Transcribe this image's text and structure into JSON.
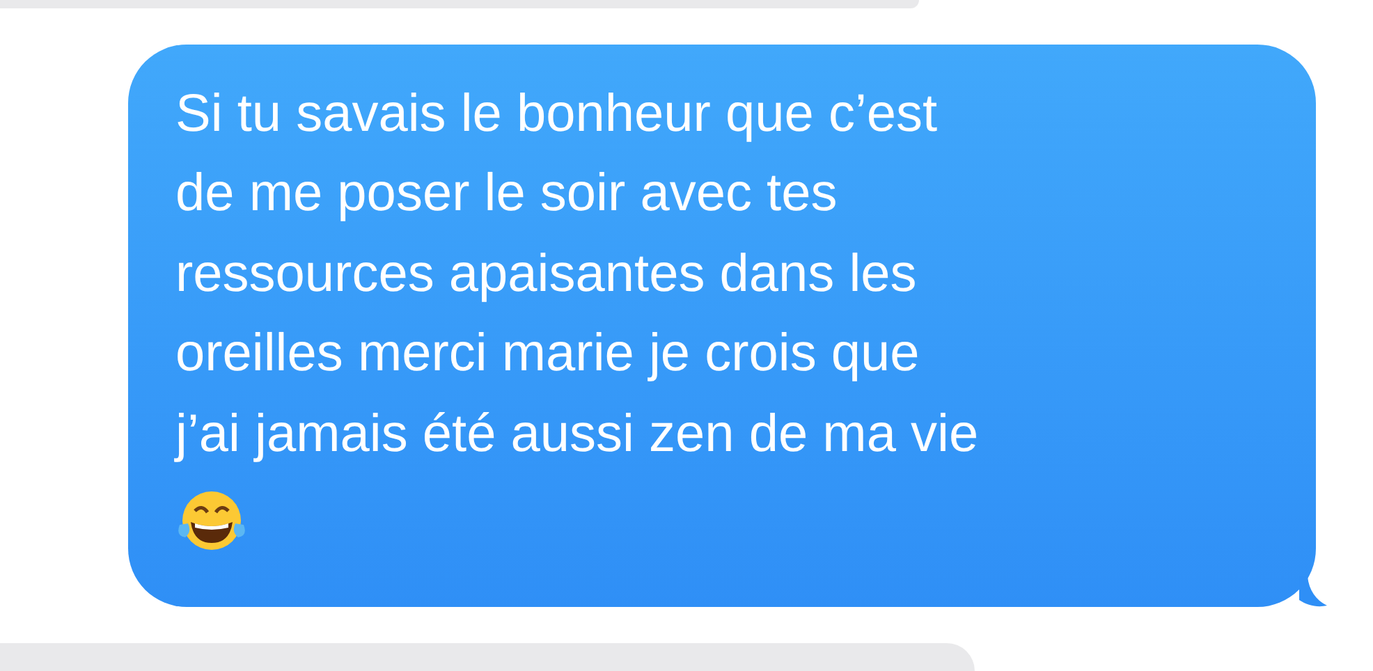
{
  "messages": [
    {
      "kind": "received"
    },
    {
      "kind": "sent",
      "text": "Si tu savais le bonheur que c’est\nde me poser le soir avec tes\nressources apaisantes dans les\noreilles merci marie je crois que\nj’ai jamais été aussi zen de ma vie",
      "ends_with_emoji": true
    },
    {
      "kind": "received"
    }
  ]
}
